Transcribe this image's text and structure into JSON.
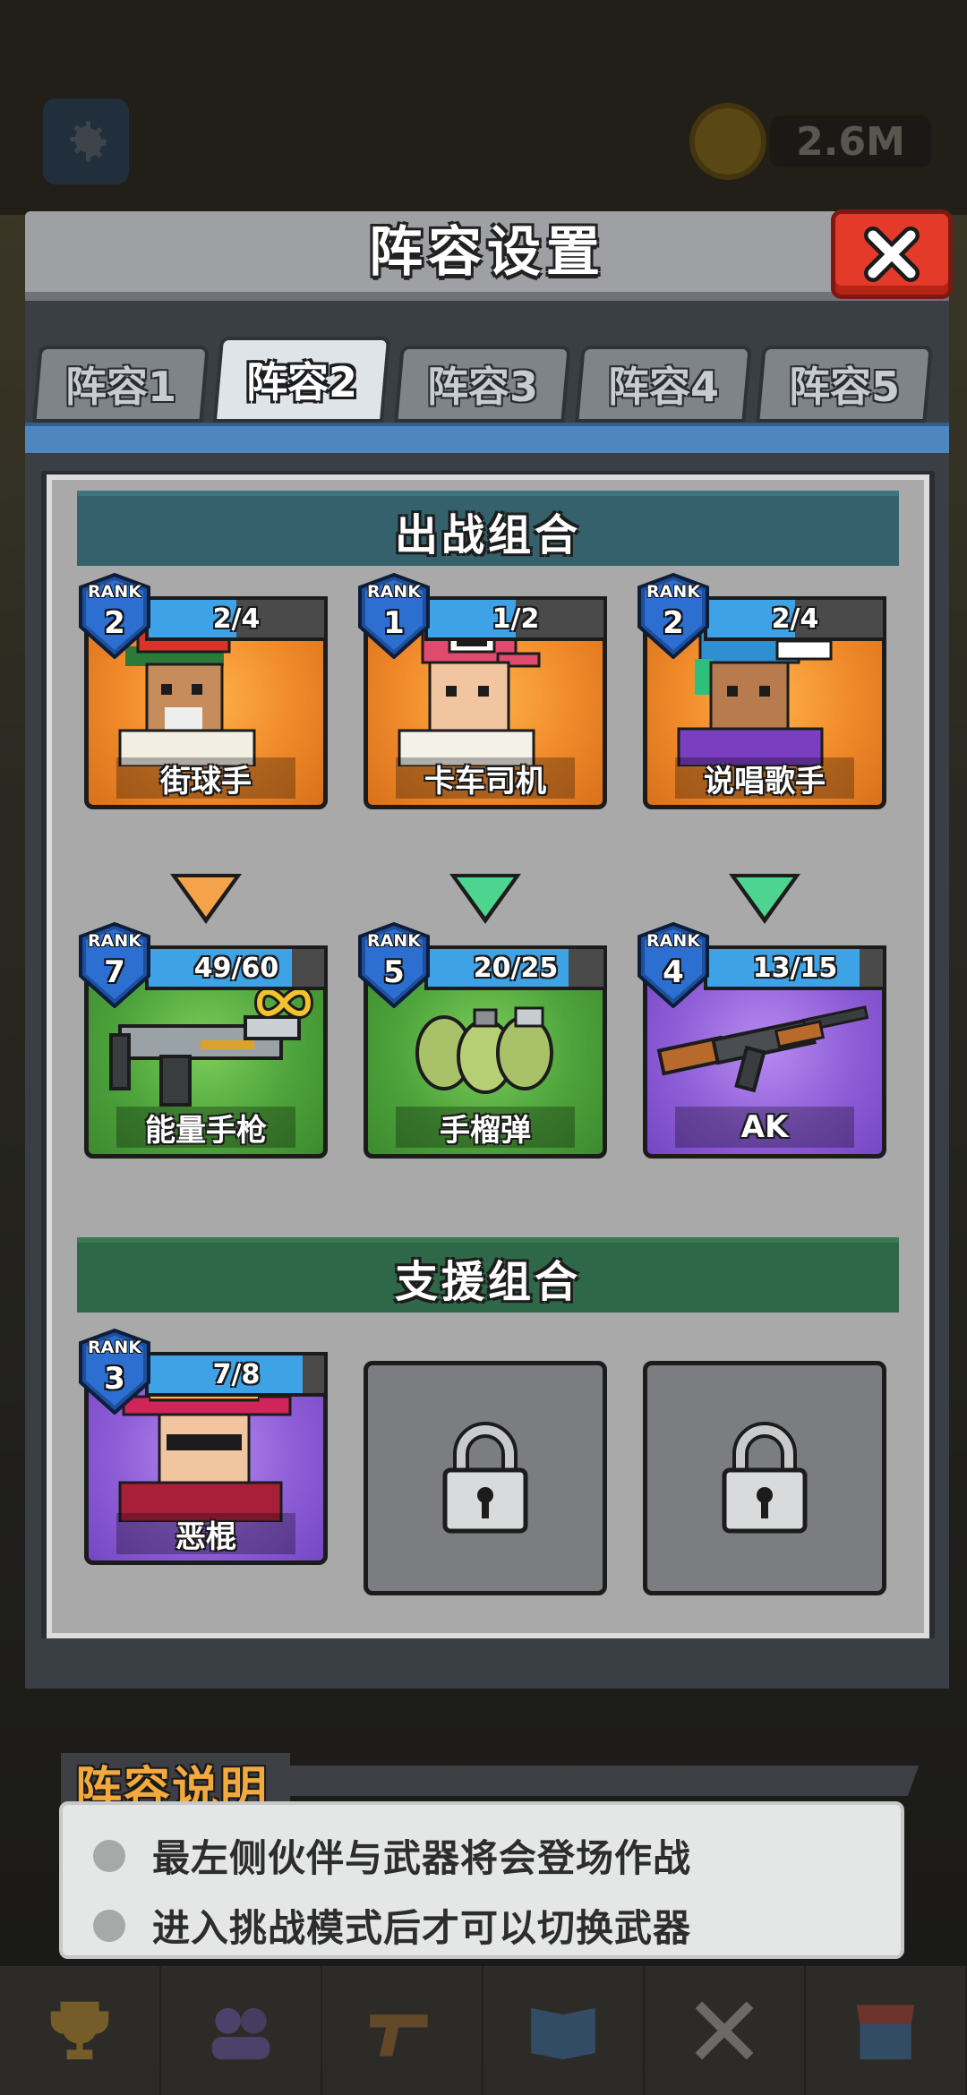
{
  "hud": {
    "coin_amount": "2.6M",
    "settings_icon": "gear-icon",
    "coin_icon": "coin-icon"
  },
  "modal": {
    "title": "阵容设置",
    "close_icon": "close-icon"
  },
  "tabs": [
    {
      "label": "阵容1",
      "active": false
    },
    {
      "label": "阵容2",
      "active": true
    },
    {
      "label": "阵容3",
      "active": false
    },
    {
      "label": "阵容4",
      "active": false
    },
    {
      "label": "阵容5",
      "active": false
    }
  ],
  "battle_section": {
    "title": "出战组合",
    "partners": [
      {
        "name": "街球手",
        "rank_label": "RANK",
        "rank": "2",
        "progress_text": "2/4",
        "progress": 0.5,
        "bg": "orange",
        "arrow": "orange"
      },
      {
        "name": "卡车司机",
        "rank_label": "RANK",
        "rank": "1",
        "progress_text": "1/2",
        "progress": 0.5,
        "bg": "orange",
        "arrow": "green"
      },
      {
        "name": "说唱歌手",
        "rank_label": "RANK",
        "rank": "2",
        "progress_text": "2/4",
        "progress": 0.5,
        "bg": "orange",
        "arrow": "green"
      }
    ],
    "weapons": [
      {
        "name": "能量手枪",
        "rank_label": "RANK",
        "rank": "7",
        "progress_text": "49/60",
        "progress": 0.8167,
        "bg": "green",
        "infinite_icon": "infinity-icon"
      },
      {
        "name": "手榴弹",
        "rank_label": "RANK",
        "rank": "5",
        "progress_text": "20/25",
        "progress": 0.8,
        "bg": "green"
      },
      {
        "name": "AK",
        "rank_label": "RANK",
        "rank": "4",
        "progress_text": "13/15",
        "progress": 0.8667,
        "bg": "purple"
      }
    ]
  },
  "support_section": {
    "title": "支援组合",
    "partner": {
      "name": "恶棍",
      "rank_label": "RANK",
      "rank": "3",
      "progress_text": "7/8",
      "progress": 0.875,
      "bg": "purple"
    },
    "locked_slots": 2,
    "lock_icon": "lock-icon"
  },
  "info": {
    "title": "阵容说明",
    "lines": [
      "最左侧伙伴与武器将会登场作战",
      "进入挑战模式后才可以切换武器"
    ]
  },
  "bottom_nav": [
    "trophy-icon",
    "team-icon",
    "pistol-icon",
    "book-icon",
    "battle-icon",
    "shop-icon"
  ],
  "colors": {
    "accent_blue": "#3ea3e6",
    "close_red": "#e33a2a",
    "info_title_orange": "#f3a93c"
  }
}
